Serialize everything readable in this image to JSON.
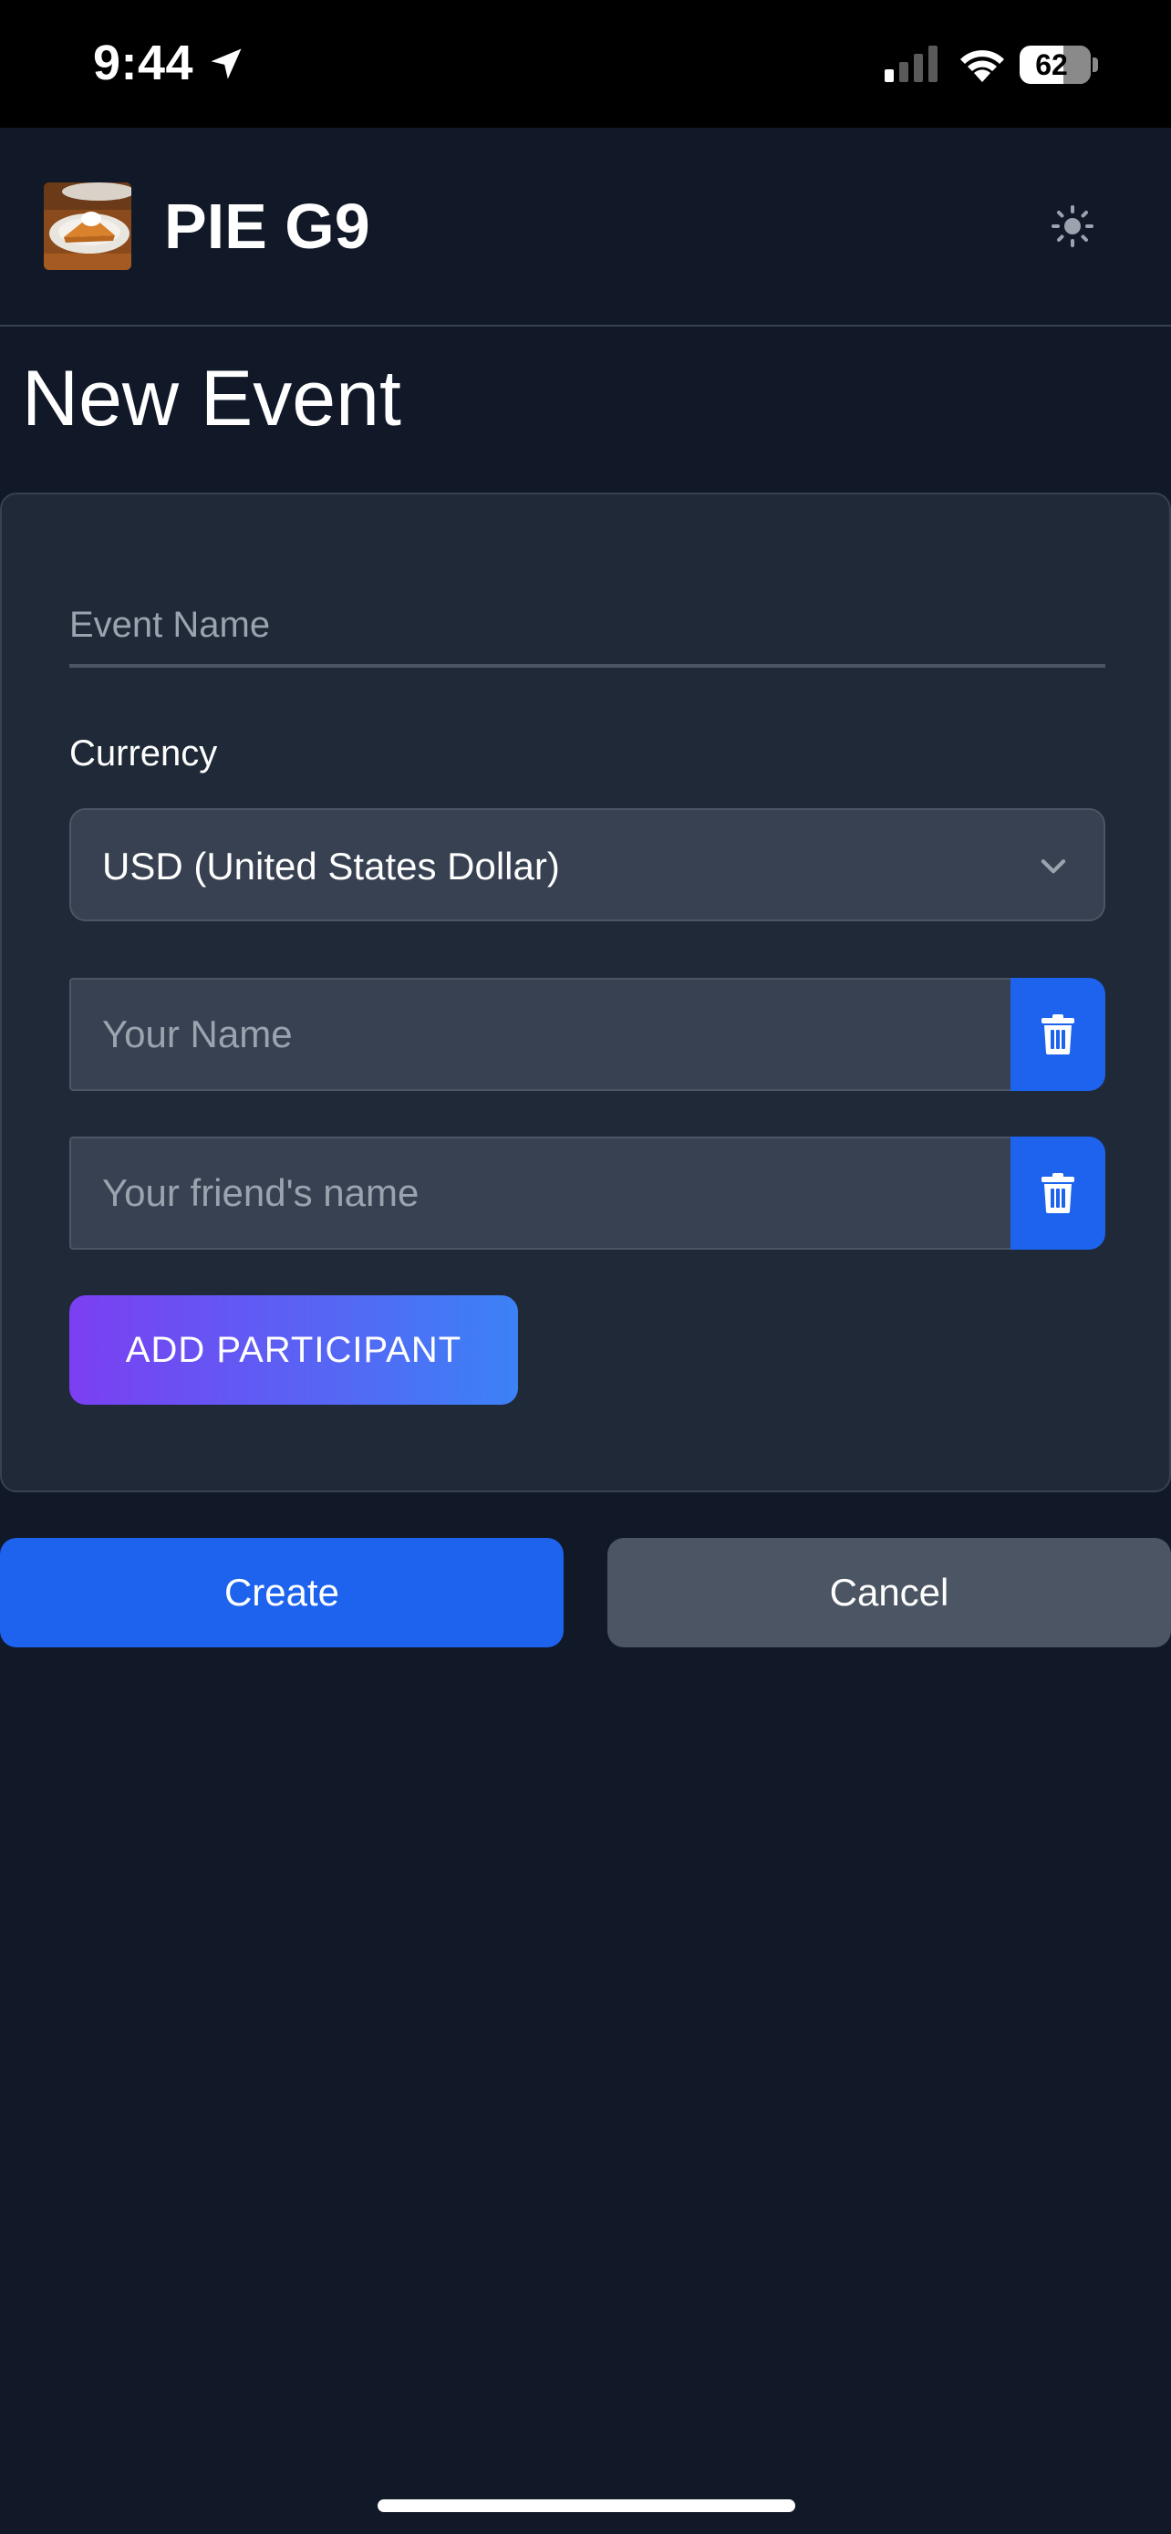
{
  "status_bar": {
    "time": "9:44",
    "battery": "62",
    "battery_level_percent": 62,
    "icons": [
      "location-arrow-icon",
      "cellular-signal-icon",
      "wifi-icon",
      "battery-icon"
    ]
  },
  "header": {
    "app_title": "PIE G9",
    "logo": "pie-slice-logo",
    "theme_toggle_icon": "sun-icon"
  },
  "page": {
    "title": "New Event"
  },
  "form": {
    "event_name_placeholder": "Event Name",
    "event_name_value": "",
    "currency_label": "Currency",
    "currency_value": "USD (United States Dollar)",
    "participants": [
      {
        "placeholder": "Your Name",
        "value": ""
      },
      {
        "placeholder": "Your friend's name",
        "value": ""
      }
    ],
    "add_participant_label": "ADD PARTICIPANT"
  },
  "actions": {
    "create_label": "Create",
    "cancel_label": "Cancel"
  },
  "colors": {
    "background": "#111827",
    "card": "#1f2937",
    "input": "#374151",
    "primary": "#1d63ed",
    "secondary": "#4b5563",
    "gradient_start": "#7b3ff2",
    "gradient_end": "#3b82f6"
  }
}
